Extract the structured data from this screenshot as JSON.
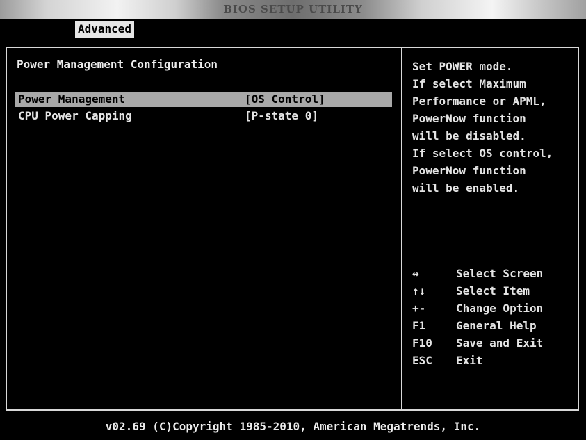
{
  "window": {
    "title": "BIOS SETUP UTILITY"
  },
  "tabs": {
    "active": "Advanced"
  },
  "page": {
    "title": "Power Management Configuration"
  },
  "settings": [
    {
      "label": "Power Management",
      "value": "[OS Control]",
      "selected": true
    },
    {
      "label": "CPU Power Capping",
      "value": "[P-state 0]",
      "selected": false
    }
  ],
  "help": {
    "lines": [
      "Set POWER mode.",
      "If select Maximum",
      "Performance or APML,",
      "PowerNow function",
      "will be disabled.",
      "If select OS control,",
      "PowerNow function",
      "will be enabled."
    ]
  },
  "keys": [
    {
      "key": "↔",
      "desc": "Select Screen"
    },
    {
      "key": "↑↓",
      "desc": "Select Item"
    },
    {
      "key": "+-",
      "desc": "Change Option"
    },
    {
      "key": "F1",
      "desc": "General Help"
    },
    {
      "key": "F10",
      "desc": "Save and Exit"
    },
    {
      "key": "ESC",
      "desc": "Exit"
    }
  ],
  "footer": {
    "text": "v02.69 (C)Copyright 1985-2010, American Megatrends, Inc."
  }
}
